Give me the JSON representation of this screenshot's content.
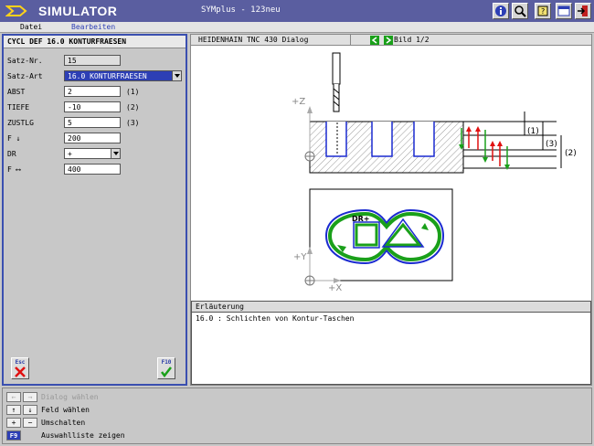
{
  "window": {
    "app_title": "SIMULATOR",
    "doc_title": "SYMplus - 123neu"
  },
  "menu": {
    "items": [
      "Datei",
      "Bearbeiten"
    ]
  },
  "form": {
    "header": "CYCL DEF 16.0 KONTURFRAESEN",
    "rows": [
      {
        "label": "Satz-Nr.",
        "value": "15",
        "unit": ""
      },
      {
        "label": "Satz-Art",
        "value": "16.0 KONTURFRAESEN",
        "unit": ""
      },
      {
        "label": "ABST",
        "value": "2",
        "unit": "(1)"
      },
      {
        "label": "TIEFE",
        "value": "-10",
        "unit": "(2)"
      },
      {
        "label": "ZUSTLG",
        "value": "5",
        "unit": "(3)"
      },
      {
        "label": "F ↓",
        "value": "200",
        "unit": ""
      },
      {
        "label": "DR",
        "value": "+",
        "unit": ""
      },
      {
        "label": "F ⟷",
        "value": "400",
        "unit": ""
      }
    ],
    "esc_label": "Esc",
    "f10_label": "F10"
  },
  "dialog": {
    "header": "HEIDENHAIN TNC 430 Dialog",
    "page": "Bild 1/2",
    "drawing": {
      "axis_z": "+Z",
      "axis_y": "+Y",
      "axis_x": "+X",
      "mark1": "(1)",
      "mark2": "(2)",
      "mark3": "(3)",
      "dr": "DR+"
    }
  },
  "erlaeuterung": {
    "header": "Erläuterung",
    "text": "16.0 : Schlichten von Kontur-Taschen"
  },
  "help": {
    "rows": [
      {
        "keys": [
          "←",
          "→"
        ],
        "text": "Dialog wählen",
        "dim": true
      },
      {
        "keys": [
          "↑",
          "↓"
        ],
        "text": "Feld wählen",
        "dim": false
      },
      {
        "keys": [
          "+",
          "−"
        ],
        "text": "Umschalten",
        "dim": false
      },
      {
        "keys": [
          "F9"
        ],
        "text": "Auswahlliste zeigen",
        "dim": false
      }
    ]
  },
  "colors": {
    "titlebar": "#5a5ea0",
    "accent": "#2d3fb5",
    "panel_border": "#3a4fb0",
    "contour_green": "#1aa01a",
    "path_blue": "#1a2ad0",
    "arrow_red": "#e01010"
  }
}
